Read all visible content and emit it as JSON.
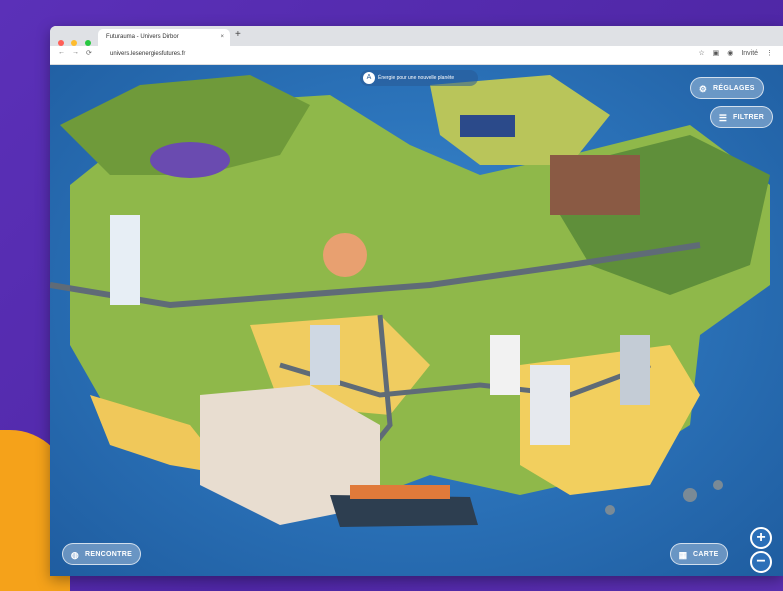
{
  "browser": {
    "tab_title": "Futurauma - Univers Dirbor",
    "tab_close": "×",
    "new_tab": "+",
    "url": "univers.lesenergiesfutures.fr",
    "nav": {
      "back": "←",
      "forward": "→",
      "reload": "⟳"
    },
    "toolbar": {
      "star": "☆",
      "ext": "▣",
      "profile": "◉",
      "profile_label": "Invité",
      "menu": "⋮"
    },
    "dot_colors": [
      "#ff5f57",
      "#febc2e",
      "#28c840"
    ]
  },
  "scene": {
    "top_badge": "Énergie pour une nouvelle planète",
    "top_badge_icon": "A",
    "settings_button": "Réglages",
    "settings_icon": "gear-icon",
    "filter_button": "Filtrer",
    "filter_icon": "filter-icon",
    "encounter_button": "Rencontre",
    "encounter_icon": "chat-icon",
    "map_button": "Carte",
    "map_icon": "map-icon",
    "zoom_in": "+",
    "zoom_out": "−"
  }
}
